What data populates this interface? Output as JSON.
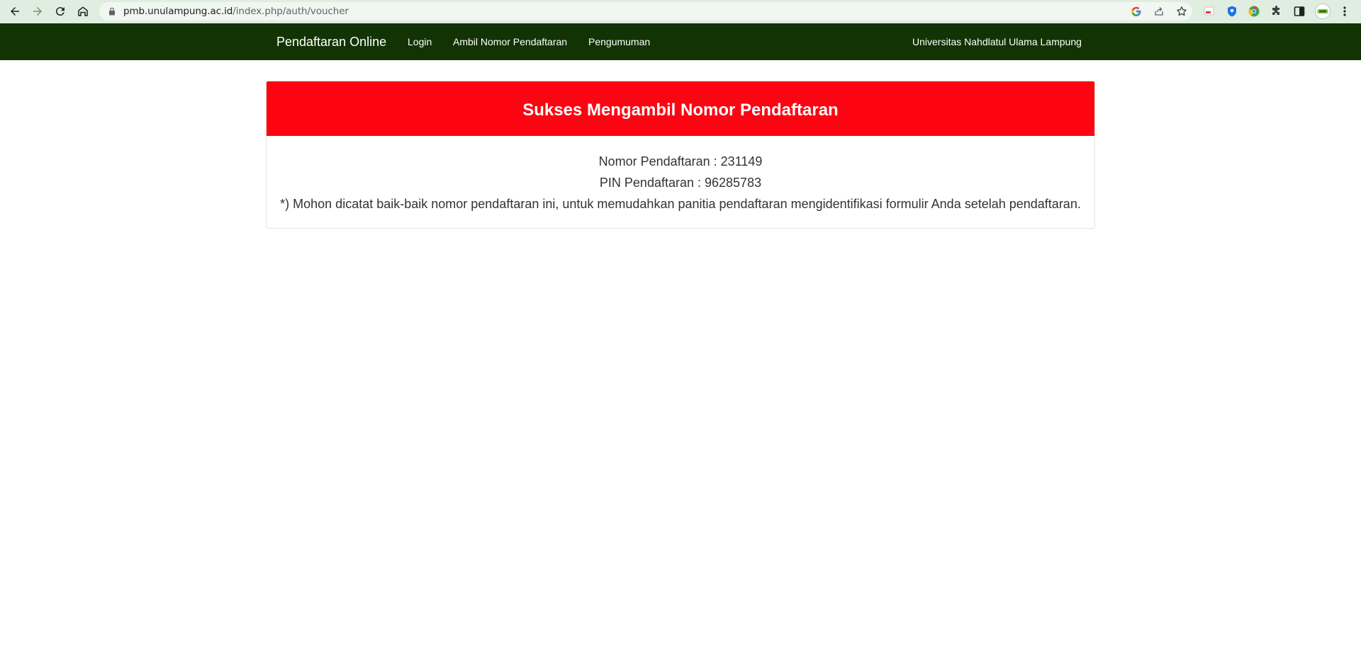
{
  "browser": {
    "url_host": "pmb.unulampung.ac.id",
    "url_path": "/index.php/auth/voucher"
  },
  "navbar": {
    "brand": "Pendaftaran Online",
    "links": [
      "Login",
      "Ambil Nomor Pendaftaran",
      "Pengumuman"
    ],
    "right_text": "Universitas Nahdlatul Ulama Lampung",
    "background": "#123404"
  },
  "panel": {
    "title": "Sukses Mengambil Nomor Pendaftaran",
    "heading_color": "#fe0311",
    "registration_number_line": "Nomor Pendaftaran : 231149",
    "pin_line": "PIN Pendaftaran : 96285783",
    "note": "*) Mohon dicatat baik-baik nomor pendaftaran ini, untuk memudahkan panitia pendaftaran mengidentifikasi formulir Anda setelah pendaftaran."
  }
}
